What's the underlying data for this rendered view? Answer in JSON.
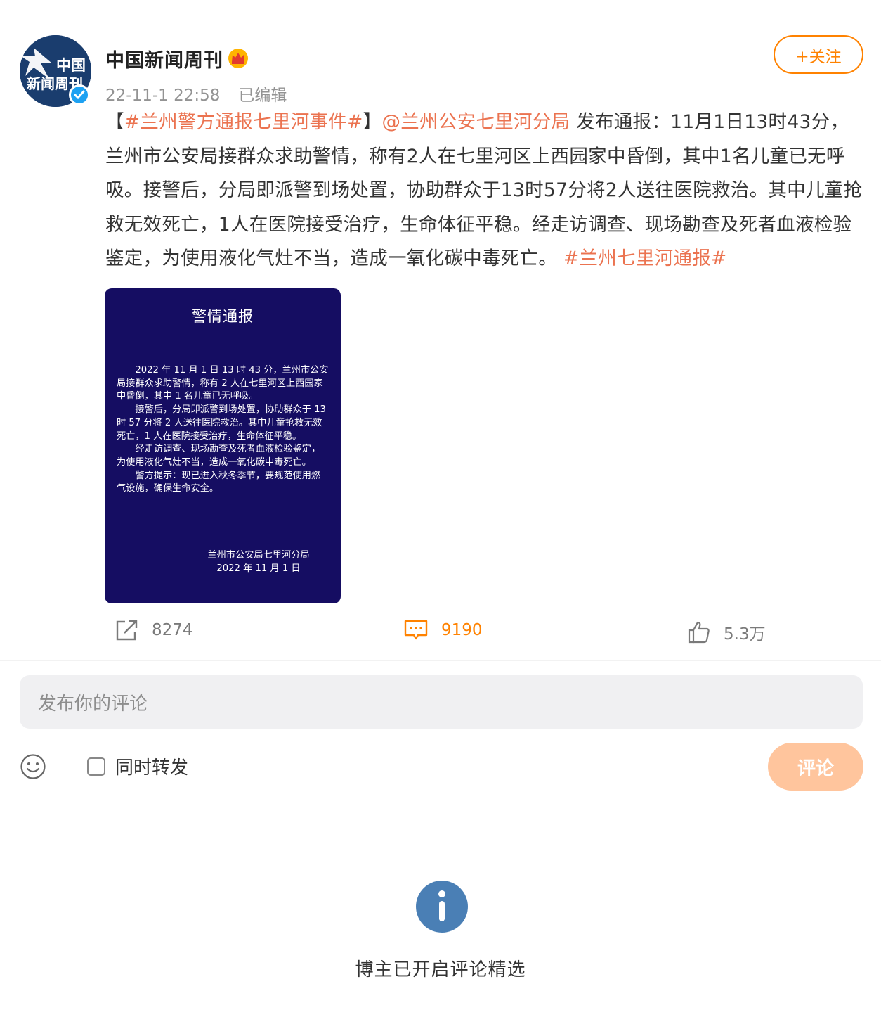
{
  "author": {
    "name": "中国新闻周刊",
    "avatar_text": [
      "中国",
      "新闻周刊"
    ],
    "timestamp": "22-11-1 22:58",
    "edited": "已编辑",
    "follow_label": "+关注"
  },
  "post": {
    "hashtag_event": "#兰州警方通报七里河事件#",
    "bracket_open": "【",
    "bracket_close": "】",
    "mention": "@兰州公安七里河分局",
    "body": " 发布通报：11月1日13时43分，兰州市公安局接群众求助警情，称有2人在七里河区上西园家中昏倒，其中1名儿童已无呼吸。接警后，分局即派警到场处置，协助群众于13时57分将2人送往医院救治。其中儿童抢救无效死亡，1人在医院接受治疗，生命体征平稳。经走访调查、现场勘查及死者血液检验鉴定，为使用液化气灶不当，造成一氧化碳中毒死亡。 ",
    "hashtag_tail": "#兰州七里河通报#"
  },
  "notice_image": {
    "title": "警情通报",
    "paragraphs": [
      "2022 年 11 月 1 日 13 时 43 分，兰州市公安局接群众求助警情，称有 2 人在七里河区上西园家中昏倒，其中 1 名儿童已无呼吸。",
      "接警后，分局即派警到场处置，协助群众于 13 时 57 分将 2 人送往医院救治。其中儿童抢救无效死亡，1 人在医院接受治疗，生命体征平稳。",
      "经走访调查、现场勘查及死者血液检验鉴定，为使用液化气灶不当，造成一氧化碳中毒死亡。",
      "警方提示：现已进入秋冬季节，要规范使用燃气设施，确保生命安全。"
    ],
    "signature": "兰州市公安局七里河分局",
    "date": "2022 年 11 月 1 日"
  },
  "actions": {
    "repost_count": "8274",
    "comment_count": "9190",
    "like_count": "5.3万"
  },
  "comment_box": {
    "placeholder": "发布你的评论",
    "repost_checkbox_label": "同时转发",
    "submit_label": "评论"
  },
  "footer": {
    "selected_notice": "博主已开启评论精选"
  },
  "colors": {
    "accent": "#ff8200",
    "link": "#eb7350",
    "notice_bg": "#150d62",
    "info_icon": "#4a7fb5"
  },
  "icons": [
    "repost-icon",
    "comment-icon",
    "like-icon",
    "emoji-icon",
    "info-icon",
    "crown-icon",
    "verified-icon"
  ]
}
